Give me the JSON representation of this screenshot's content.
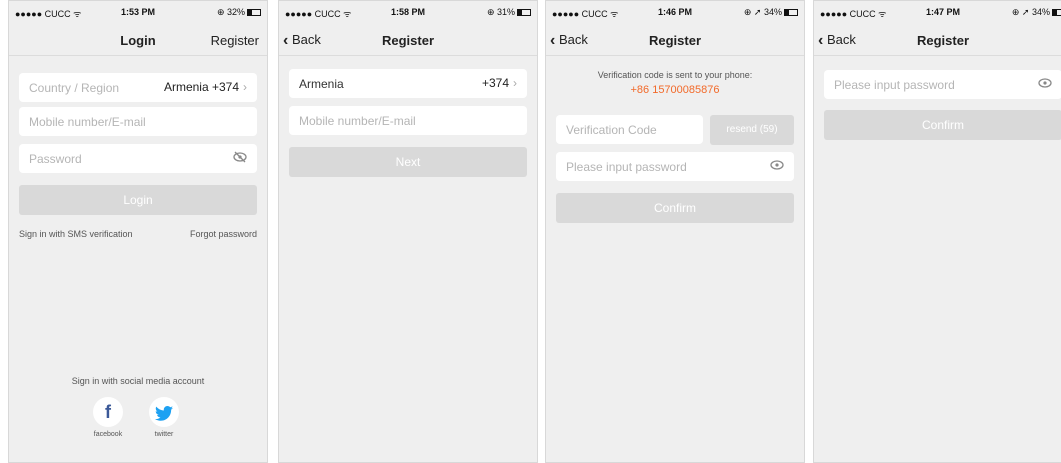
{
  "screens": [
    {
      "status": {
        "carrier": "●●●●● CUCC ᯤ",
        "time": "1:53 PM",
        "battery": "⊕ 32%"
      },
      "nav": {
        "title": "Login",
        "right": "Register"
      },
      "country_label": "Country / Region",
      "country_value": "Armenia +374",
      "mobile_placeholder": "Mobile number/E-mail",
      "password_placeholder": "Password",
      "login_button": "Login",
      "sms_link": "Sign in with SMS verification",
      "forgot_link": "Forgot password",
      "social_title": "Sign in with social media account",
      "facebook_label": "facebook",
      "twitter_label": "twitter"
    },
    {
      "status": {
        "carrier": "●●●●● CUCC ᯤ",
        "time": "1:58 PM",
        "battery": "⊕ 31%"
      },
      "nav": {
        "back": "Back",
        "title": "Register"
      },
      "country": "Armenia",
      "code": "+374",
      "mobile_placeholder": "Mobile number/E-mail",
      "next_button": "Next"
    },
    {
      "status": {
        "carrier": "●●●●● CUCC ᯤ",
        "time": "1:46 PM",
        "battery": "⊕ ➚ 34%"
      },
      "nav": {
        "back": "Back",
        "title": "Register"
      },
      "notice": "Verification code is sent to your phone:",
      "phone": "+86 15700085876",
      "code_placeholder": "Verification Code",
      "resend_button": "resend (59)",
      "password_placeholder": "Please input password",
      "confirm_button": "Confirm"
    },
    {
      "status": {
        "carrier": "●●●●● CUCC ᯤ",
        "time": "1:47 PM",
        "battery": "⊕ ➚ 34%"
      },
      "nav": {
        "back": "Back",
        "title": "Register"
      },
      "password_placeholder": "Please input password",
      "confirm_button": "Confirm"
    }
  ]
}
